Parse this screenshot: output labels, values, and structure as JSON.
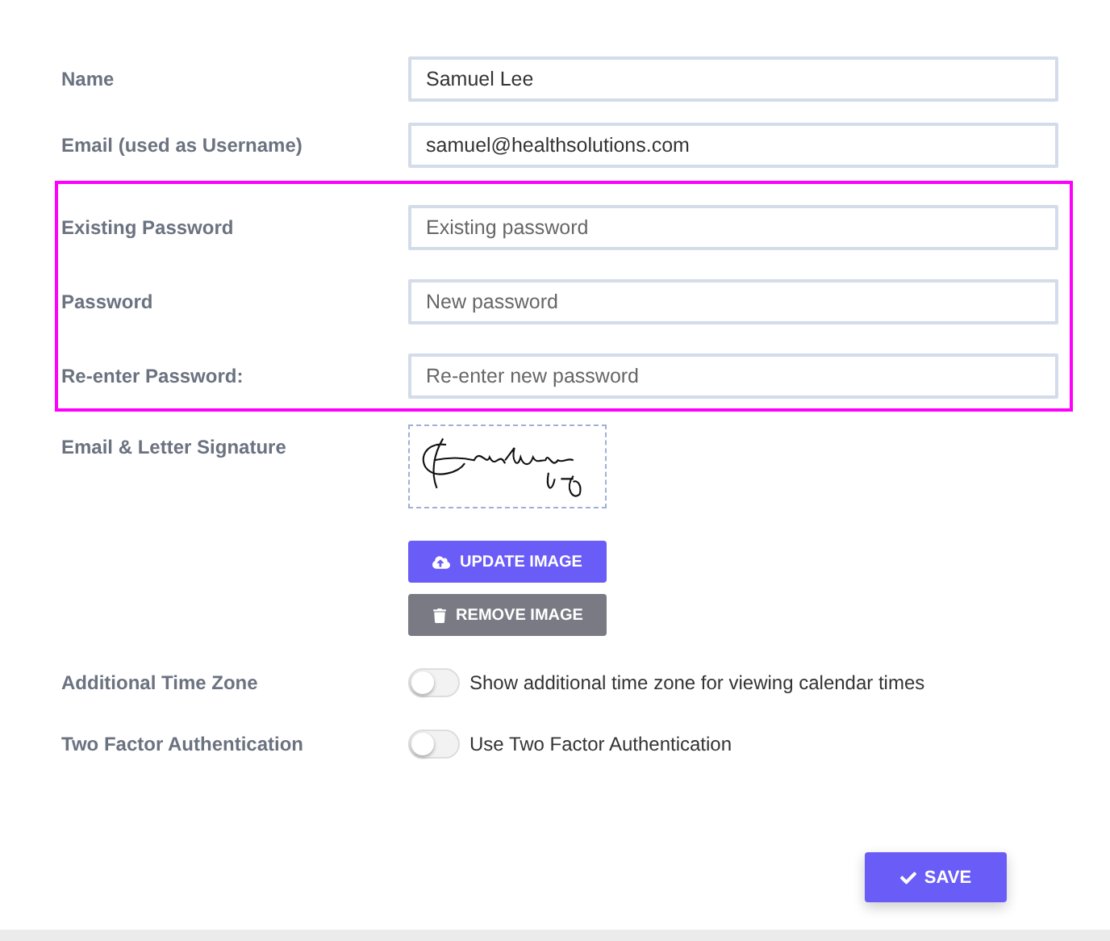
{
  "fields": [
    {
      "label": "Name",
      "value": "Samuel Lee",
      "highlighted": false
    },
    {
      "label": "Email (used as Username)",
      "value": "samuel@healthsolutions.com",
      "highlighted": false
    },
    {
      "label": "Existing Password",
      "placeholder": "Existing password",
      "highlighted": true
    },
    {
      "label": "Password",
      "placeholder": "New password",
      "highlighted": true
    },
    {
      "label": "Re-enter Password:",
      "placeholder": "Re-enter new password",
      "highlighted": true
    }
  ],
  "signature": {
    "label": "Email & Letter Signature",
    "update_button": "UPDATE IMAGE",
    "remove_button": "REMOVE IMAGE"
  },
  "toggles": [
    {
      "label": "Additional Time Zone",
      "text": "Show additional time zone for viewing calendar times",
      "on": false
    },
    {
      "label": "Two Factor Authentication",
      "text": "Use Two Factor Authentication",
      "on": false
    }
  ],
  "save_button": "SAVE"
}
